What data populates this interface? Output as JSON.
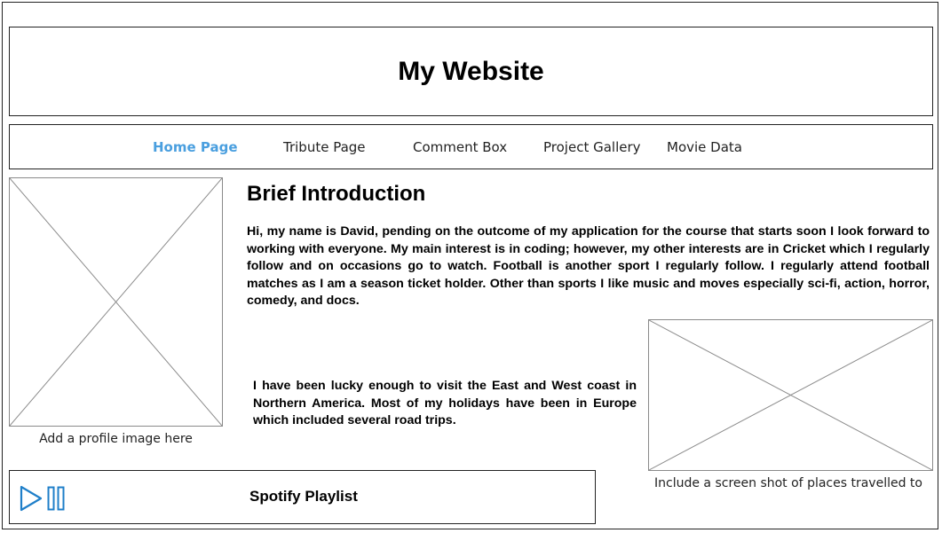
{
  "site": {
    "title": "My Website"
  },
  "nav": {
    "items": [
      {
        "label": "Home Page",
        "active": true
      },
      {
        "label": "Tribute Page",
        "active": false
      },
      {
        "label": "Comment Box",
        "active": false
      },
      {
        "label": "Project Gallery",
        "active": false
      },
      {
        "label": "Movie Data",
        "active": false
      }
    ]
  },
  "profile": {
    "caption": "Add a profile image here"
  },
  "intro": {
    "heading": "Brief Introduction",
    "paragraph1": "Hi, my name is David, pending on the outcome of my application for the course that starts soon I look forward to working with everyone. My main interest is in coding; however, my other interests are in Cricket which I regularly follow and on occasions go to watch. Football is another sport I regularly follow. I regularly attend football matches as I am a season ticket holder. Other than sports I like music and moves especially sci-fi, action, horror, comedy, and docs.",
    "paragraph2": "I have been lucky enough to visit the East and West coast in Northern America. Most of my holidays have been in Europe which included several road trips."
  },
  "travel": {
    "caption": "Include a screen shot of places travelled to"
  },
  "player": {
    "title": "Spotify Playlist",
    "play_icon": "play-icon",
    "pause_icon": "pause-icon"
  },
  "colors": {
    "accent": "#4a9fdf",
    "player_controls": "#1f7fc9",
    "border": "#222222",
    "placeholder": "#8a8a8a"
  }
}
